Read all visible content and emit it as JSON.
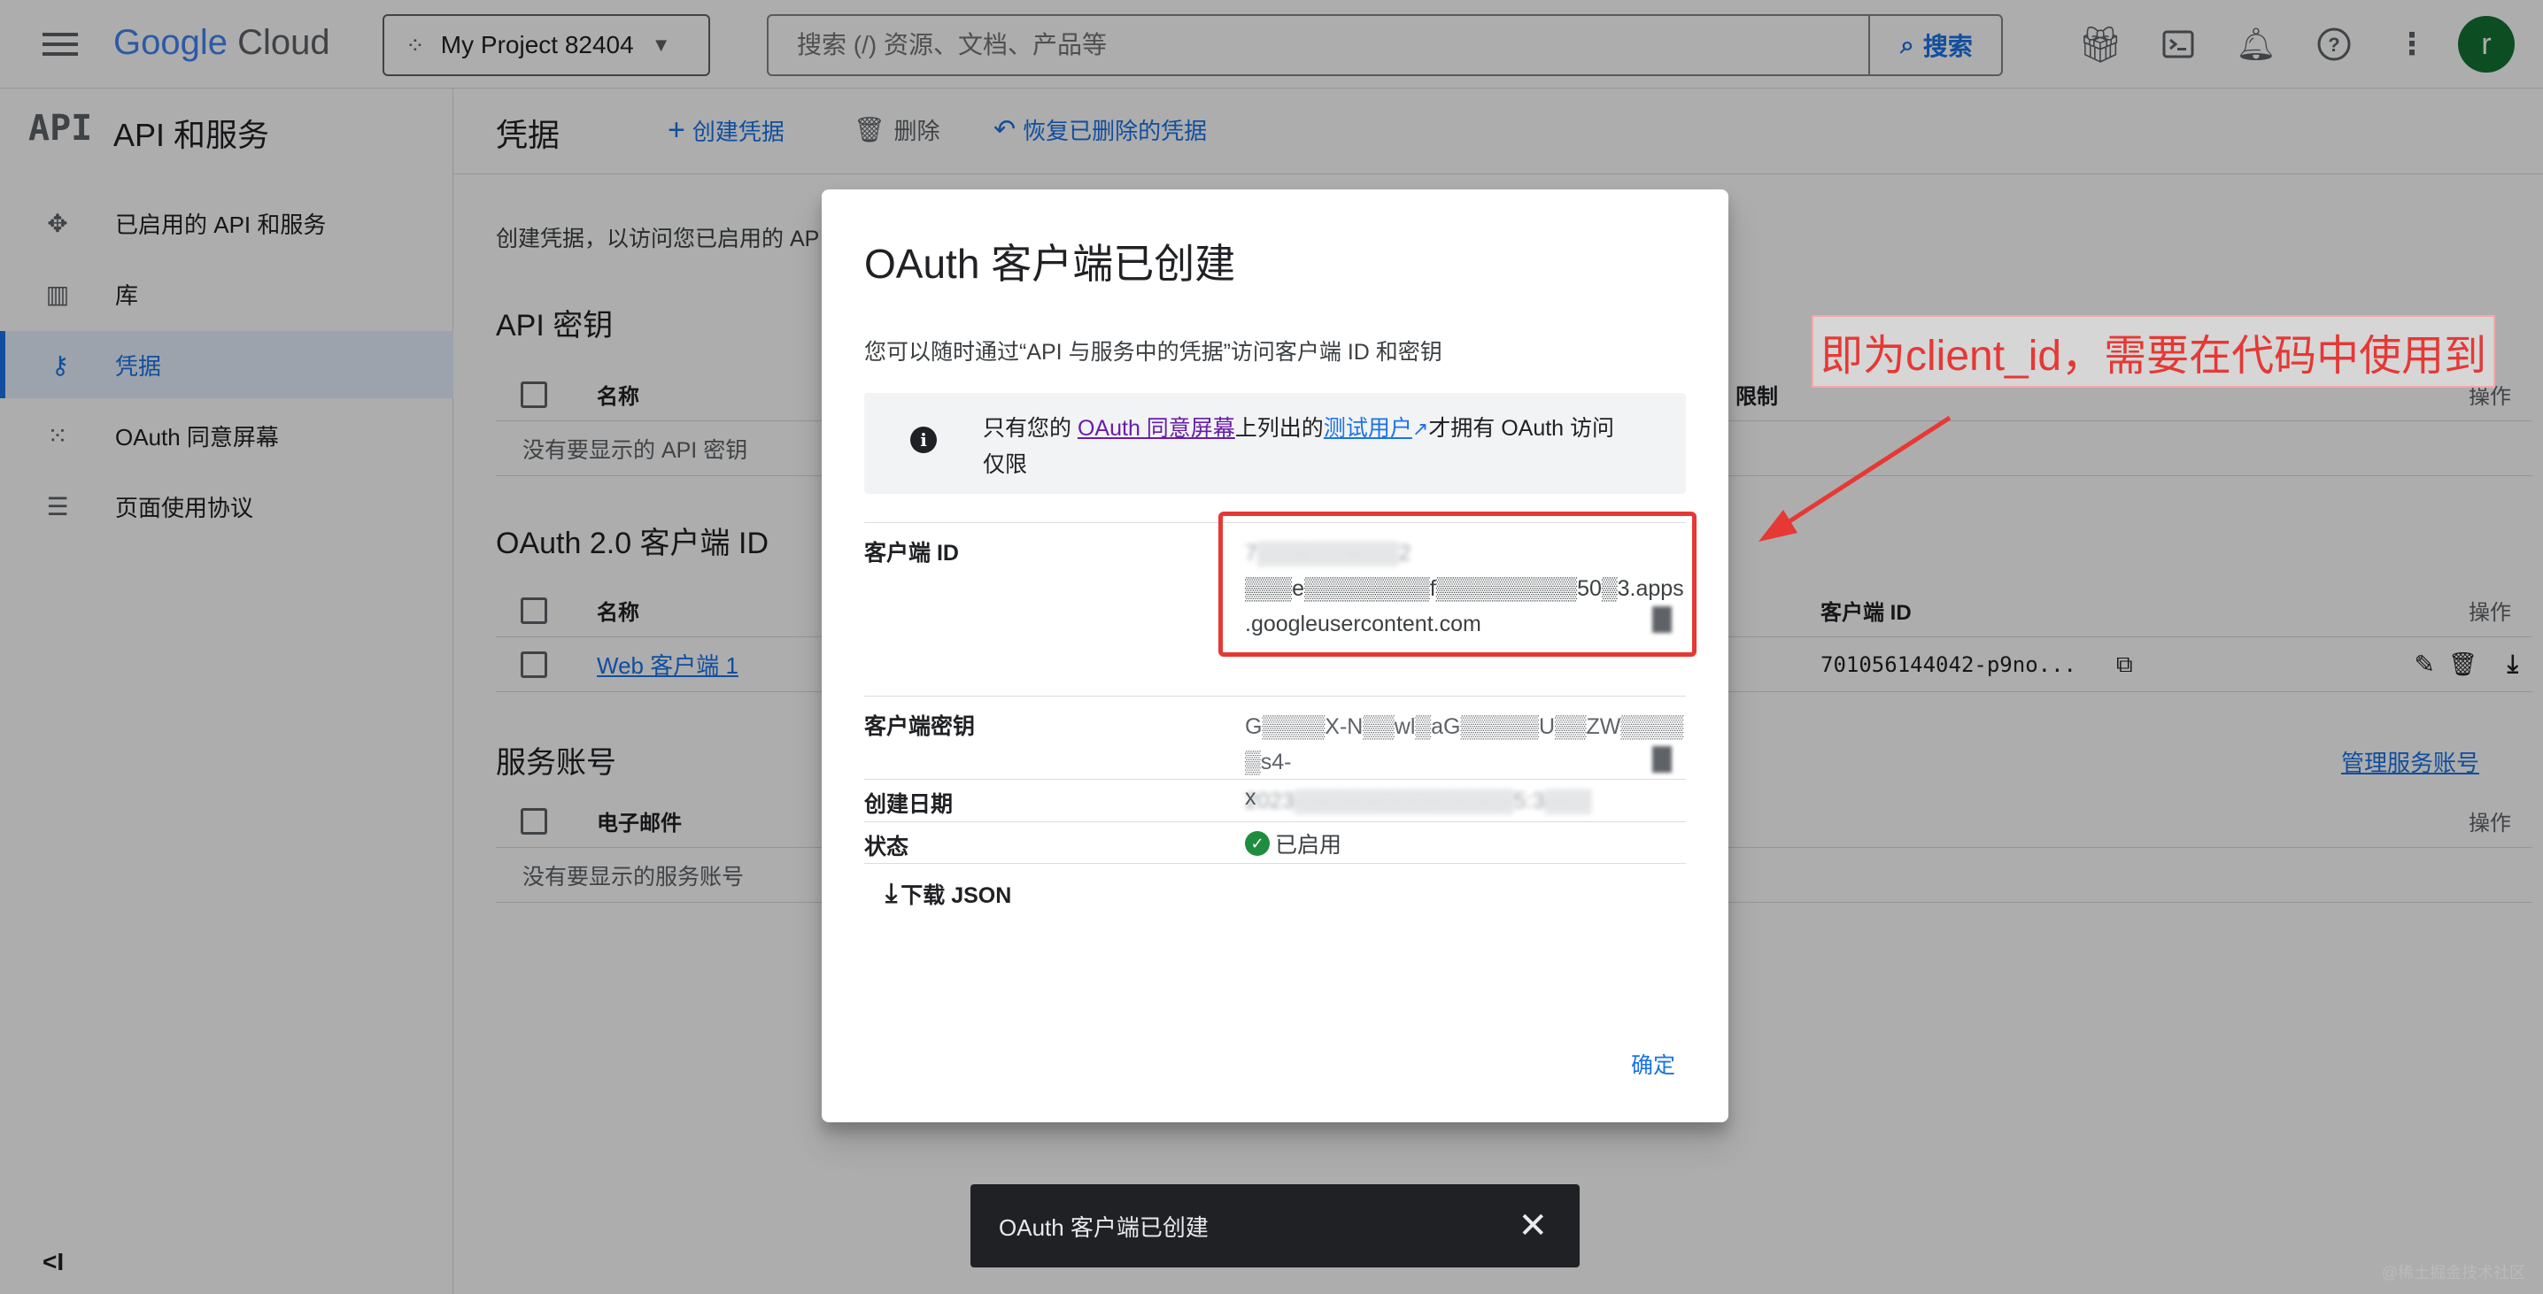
{
  "header": {
    "brand_google": "Google",
    "brand_cloud": "Cloud",
    "project": "My Project 82404",
    "search_placeholder": "搜索 (/) 资源、文档、产品等",
    "search_button": "搜索",
    "avatar": "r"
  },
  "sidebar": {
    "logo": "API",
    "title": "API 和服务",
    "items": [
      {
        "label": "已启用的 API 和服务",
        "icon": "api-diamond-icon"
      },
      {
        "label": "库",
        "icon": "library-icon"
      },
      {
        "label": "凭据",
        "icon": "key-icon"
      },
      {
        "label": "OAuth 同意屏幕",
        "icon": "consent-icon"
      },
      {
        "label": "页面使用协议",
        "icon": "settings-list-icon"
      }
    ],
    "collapse_icon": "<I"
  },
  "toolbar": {
    "title": "凭据",
    "create": "创建凭据",
    "delete": "删除",
    "restore": "恢复已删除的凭据"
  },
  "content": {
    "intro": "创建凭据，以访问您已启用的 AP",
    "api_keys": {
      "title": "API 密钥",
      "col_name": "名称",
      "col_restrict": "限制",
      "col_actions": "操作",
      "empty": "没有要显示的 API 密钥"
    },
    "oauth": {
      "title": "OAuth 2.0 客户端 ID",
      "col_name": "名称",
      "col_client_id": "客户端 ID",
      "col_actions": "操作",
      "row_name": "Web 客户端 1",
      "row_client_id": "701056144042-p9no..."
    },
    "service_accounts": {
      "title": "服务账号",
      "manage": "管理服务账号",
      "col_email": "电子邮件",
      "col_actions": "操作",
      "empty": "没有要显示的服务账号"
    }
  },
  "dialog": {
    "title": "OAuth 客户端已创建",
    "desc": "您可以随时通过“API 与服务中的凭据”访问客户端 ID 和密钥",
    "info_pre": "只有您的",
    "info_link1": "OAuth 同意屏幕",
    "info_mid": "上列出的",
    "info_link2": "测试用户",
    "info_post": "才拥有 OAuth 访问",
    "info_line2": "仅限",
    "client_id_label": "客户端 ID",
    "client_id_line1": "7▒▒▒▒▒▒▒▒▒2",
    "client_id_line2": "▒▒▒e▒▒▒▒▒▒▒▒f▒▒▒▒▒▒▒▒▒50▒3.apps",
    "client_id_line3": ".googleusercontent.com",
    "secret_label": "客户端密钥",
    "secret_line1": "G▒▒▒▒X-N▒▒wl▒aG▒▒▒▒▒U▒▒ZW▒▒▒▒▒s4-",
    "secret_line2": "x",
    "created_label": "创建日期",
    "created_value": "2023▒▒▒▒▒▒▒▒▒▒▒▒▒▒5:3▒▒▒",
    "status_label": "状态",
    "status_value": "已启用",
    "download": "下载 JSON",
    "ok": "确定"
  },
  "annotation": {
    "text": "即为client_id，需要在代码中使用到"
  },
  "snackbar": {
    "text": "OAuth 客户端已创建"
  },
  "watermark": "@稀土掘金技术社区"
}
